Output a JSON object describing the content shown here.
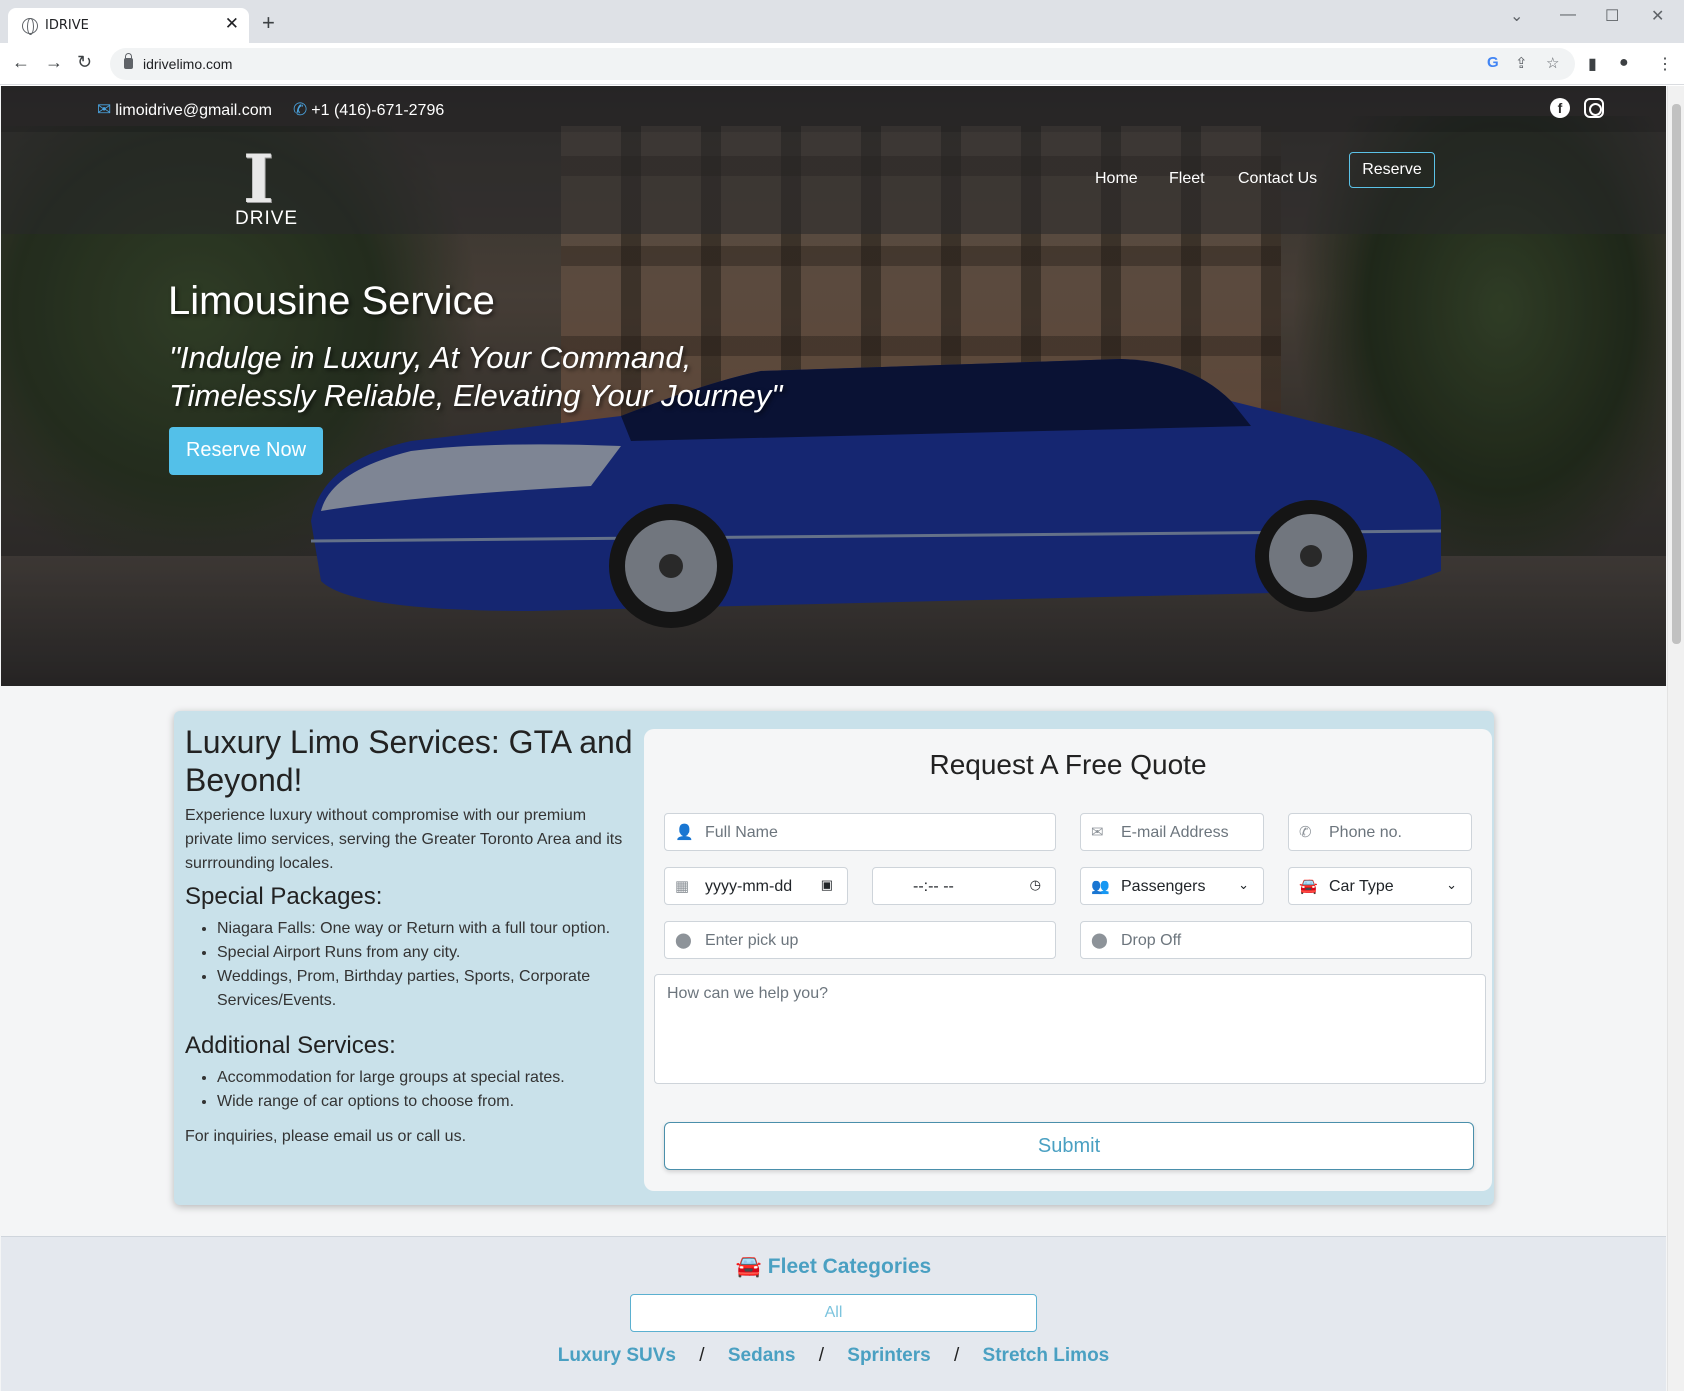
{
  "browser": {
    "tab_title": "IDRIVE",
    "url": "idrivelimo.com"
  },
  "topbar": {
    "email": "limoidrive@gmail.com",
    "phone": "+1 (416)-671-2796"
  },
  "logo": {
    "letter": "I",
    "word": "DRIVE"
  },
  "nav": {
    "home": "Home",
    "fleet": "Fleet",
    "contact": "Contact Us",
    "reserve": "Reserve"
  },
  "hero": {
    "title": "Limousine Service",
    "quote_line1": "\"Indulge in Luxury, At Your Command,",
    "quote_line2": "Timelessly Reliable, Elevating Your Journey\"",
    "button": "Reserve Now"
  },
  "info": {
    "heading": "Luxury Limo Services: GTA and Beyond!",
    "intro": "Experience luxury without compromise with our premium private limo services, serving the Greater Toronto Area and its surrrounding locales.",
    "packages_title": "Special Packages:",
    "packages": [
      "Niagara Falls: One way or Return with a full tour option.",
      "Special Airport Runs from any city.",
      "Weddings, Prom, Birthday parties, Sports, Corporate Services/Events."
    ],
    "additional_title": "Additional Services:",
    "additional": [
      "Accommodation for large groups at special rates.",
      "Wide range of car options to choose from."
    ],
    "footer": "For inquiries, please email us or call us."
  },
  "quote": {
    "title": "Request A Free Quote",
    "full_name": "Full Name",
    "email": "E-mail Address",
    "phone": "Phone no.",
    "date": "yyyy-mm-dd",
    "time": "--:-- --",
    "passengers": "Passengers",
    "car_type": "Car Type",
    "pickup": "Enter pick up",
    "dropoff": "Drop Off",
    "message": "How can we help you?",
    "submit": "Submit"
  },
  "fleet": {
    "title": "Fleet Categories",
    "all": "All",
    "categories": [
      "Luxury SUVs",
      "Sedans",
      "Sprinters",
      "Stretch Limos"
    ],
    "separator": "/"
  },
  "colors": {
    "accent": "#53c0e9",
    "link": "#4aa0c2",
    "info_bg": "#c9e1ea"
  }
}
